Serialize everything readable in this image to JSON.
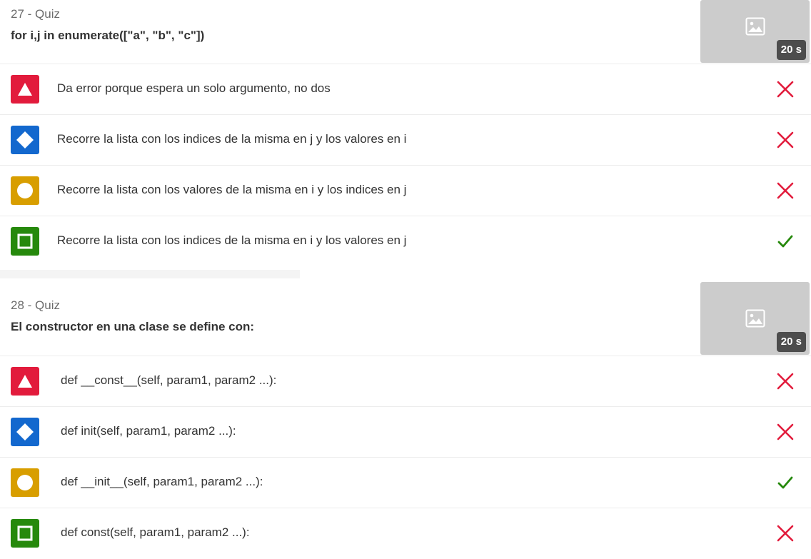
{
  "questions": [
    {
      "number_label": "27 - Quiz",
      "text": "for i,j in enumerate([\"a\", \"b\", \"c\"])",
      "time": "20 s",
      "answers": [
        {
          "text": "Da error porque espera un solo argumento, no dos",
          "shape": "triangle",
          "color": "#e21b3c",
          "correct": false
        },
        {
          "text": "Recorre la lista con los indices de la misma en j y los valores en i",
          "shape": "diamond",
          "color": "#1368ce",
          "correct": false
        },
        {
          "text": "Recorre la lista con los valores de la misma en i y los indices en j",
          "shape": "circle",
          "color": "#d89e00",
          "correct": false
        },
        {
          "text": "Recorre la lista con los indices de la misma en i y los valores en j",
          "shape": "square",
          "color": "#26890c",
          "correct": true
        }
      ]
    },
    {
      "number_label": "28 - Quiz",
      "text": "El constructor en una clase se define con:",
      "time": "20 s",
      "answers": [
        {
          "text": "def __const__(self, param1, param2 ...):",
          "shape": "triangle",
          "color": "#e21b3c",
          "correct": false
        },
        {
          "text": "def init(self, param1, param2 ...):",
          "shape": "diamond",
          "color": "#1368ce",
          "correct": false
        },
        {
          "text": "def __init__(self, param1, param2 ...):",
          "shape": "circle",
          "color": "#d89e00",
          "correct": true
        },
        {
          "text": "def const(self, param1, param2 ...):",
          "shape": "square",
          "color": "#26890c",
          "correct": false
        }
      ]
    }
  ],
  "icons": {
    "thumbnail": "image-placeholder-icon",
    "correct": "check-icon",
    "incorrect": "cross-icon"
  },
  "colors": {
    "correct_mark": "#26890c",
    "incorrect_mark": "#e21b3c",
    "thumbnail_bg": "#cccccc",
    "time_badge_bg": "#4d4d4d"
  }
}
